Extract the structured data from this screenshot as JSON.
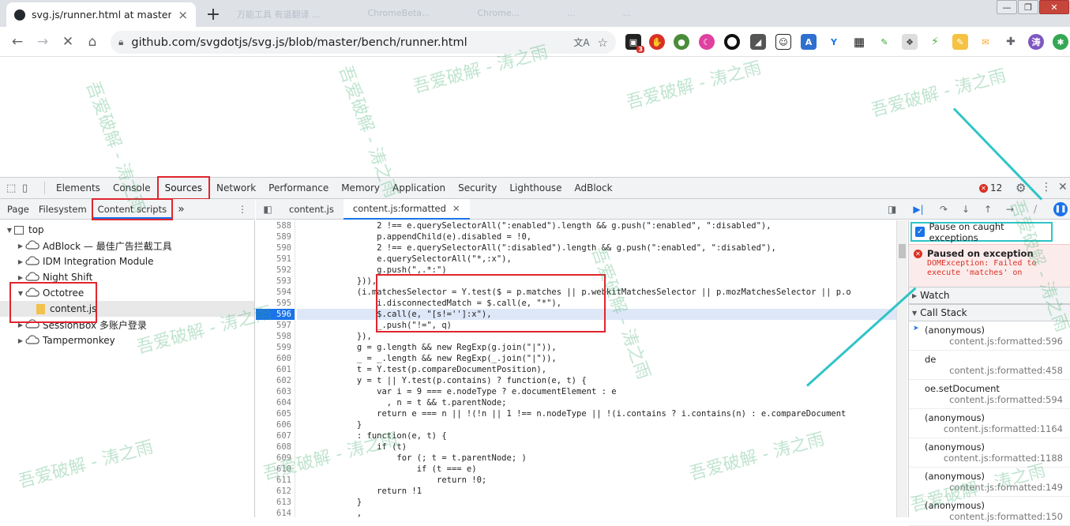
{
  "browser": {
    "tab_title": "svg.js/runner.html at master · s",
    "tab_close": "×",
    "new_tab": "+",
    "ghost_tabs": [
      "万能工具 有道翻译 ...",
      "ChromeBeta...",
      "Chrome...",
      "...",
      "...",
      "..."
    ],
    "window_buttons": [
      "—",
      "❐",
      "✕"
    ],
    "url": "github.com/svgdotjs/svg.js/blob/master/bench/runner.html",
    "profile_initial": "涛",
    "ext_badge": "3"
  },
  "devtools": {
    "main_tabs": [
      "Elements",
      "Console",
      "Sources",
      "Network",
      "Performance",
      "Memory",
      "Application",
      "Security",
      "Lighthouse",
      "AdBlock"
    ],
    "active_tab": "Sources",
    "error_count": "12",
    "nav_tabs": [
      "Page",
      "Filesystem",
      "Content scripts"
    ],
    "more": "»",
    "editor_tabs": [
      "content.js",
      "content.js:formatted"
    ],
    "tree": [
      {
        "label": "top",
        "depth": 0,
        "arrow": "▼",
        "icon": "frame"
      },
      {
        "label": "AdBlock — 最佳广告拦截工具",
        "depth": 1,
        "arrow": "▶",
        "icon": "cloud"
      },
      {
        "label": "IDM Integration Module",
        "depth": 1,
        "arrow": "▶",
        "icon": "cloud"
      },
      {
        "label": "Night Shift",
        "depth": 1,
        "arrow": "▶",
        "icon": "cloud"
      },
      {
        "label": "Octotree",
        "depth": 1,
        "arrow": "▼",
        "icon": "cloud"
      },
      {
        "label": "content.js",
        "depth": 2,
        "arrow": "",
        "icon": "file"
      },
      {
        "label": "SessionBox 多账户登录",
        "depth": 1,
        "arrow": "▶",
        "icon": "cloud"
      },
      {
        "label": "Tampermonkey",
        "depth": 1,
        "arrow": "▶",
        "icon": "cloud"
      }
    ],
    "code_lines": [
      {
        "n": "588",
        "t": "                2 !== e.querySelectorAll(\":enabled\").length && g.push(\":enabled\", \":disabled\"),"
      },
      {
        "n": "589",
        "t": "                p.appendChild(e).disabled = !0,"
      },
      {
        "n": "590",
        "t": "                2 !== e.querySelectorAll(\":disabled\").length && g.push(\":enabled\", \":disabled\"),"
      },
      {
        "n": "591",
        "t": "                e.querySelectorAll(\"*,:x\"),"
      },
      {
        "n": "592",
        "t": "                g.push(\",.*:\")"
      },
      {
        "n": "593",
        "t": "            })),"
      },
      {
        "n": "594",
        "t": "            (i.matchesSelector = Y.test($ = p.matches || p.webkitMatchesSelector || p.mozMatchesSelector || p.o"
      },
      {
        "n": "595",
        "t": "                i.disconnectedMatch = $.call(e, \"*\"),"
      },
      {
        "n": "596",
        "t": "                $.call(e, \"[s!='']:x\"),"
      },
      {
        "n": "597",
        "t": "                _.push(\"!=\", q)"
      },
      {
        "n": "598",
        "t": "            }),"
      },
      {
        "n": "599",
        "t": "            g = g.length && new RegExp(g.join(\"|\")),"
      },
      {
        "n": "600",
        "t": "            _ = _.length && new RegExp(_.join(\"|\")),"
      },
      {
        "n": "601",
        "t": "            t = Y.test(p.compareDocumentPosition),"
      },
      {
        "n": "602",
        "t": "            y = t || Y.test(p.contains) ? function(e, t) {"
      },
      {
        "n": "603",
        "t": "                var i = 9 === e.nodeType ? e.documentElement : e"
      },
      {
        "n": "604",
        "t": "                  , n = t && t.parentNode;"
      },
      {
        "n": "605",
        "t": "                return e === n || !(!n || 1 !== n.nodeType || !(i.contains ? i.contains(n) : e.compareDocument"
      },
      {
        "n": "606",
        "t": "            }"
      },
      {
        "n": "607",
        "t": "            : function(e, t) {"
      },
      {
        "n": "608",
        "t": "                if (t)"
      },
      {
        "n": "609",
        "t": "                    for (; t = t.parentNode; )"
      },
      {
        "n": "610",
        "t": "                        if (t === e)"
      },
      {
        "n": "611",
        "t": "                            return !0;"
      },
      {
        "n": "612",
        "t": "                return !1"
      },
      {
        "n": "613",
        "t": "            }"
      },
      {
        "n": "614",
        "t": "            ,"
      }
    ],
    "pause_caught": "Pause on caught exceptions",
    "paused_title": "Paused on exception",
    "exception_text": "DOMException: Failed to execute 'matches' on",
    "watch": "Watch",
    "call_stack": "Call Stack",
    "stack": [
      {
        "fn": "(anonymous)",
        "loc": "content.js:formatted:596"
      },
      {
        "fn": "de",
        "loc": "content.js:formatted:458"
      },
      {
        "fn": "oe.setDocument",
        "loc": "content.js:formatted:594"
      },
      {
        "fn": "(anonymous)",
        "loc": "content.js:formatted:1164"
      },
      {
        "fn": "(anonymous)",
        "loc": "content.js:formatted:1188"
      },
      {
        "fn": "(anonymous)",
        "loc": "content.js:formatted:149"
      },
      {
        "fn": "(anonymous)",
        "loc": "content.js:formatted:150"
      }
    ]
  },
  "watermark": "吾爱破解 - 涛之雨",
  "colors": {
    "accent": "#1a73e8",
    "annotation_red": "#e0252e",
    "annotation_cyan": "#2fc4c8",
    "error": "#d93025"
  }
}
